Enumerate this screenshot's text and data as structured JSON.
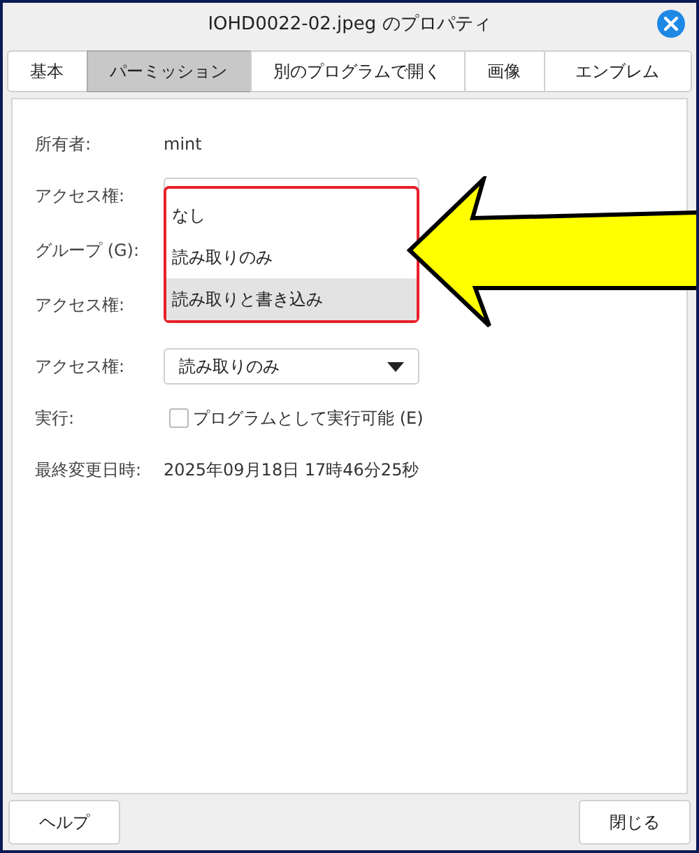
{
  "window": {
    "title": "IOHD0022-02.jpeg のプロパティ"
  },
  "tabs": [
    {
      "label": "基本",
      "selected": false
    },
    {
      "label": "パーミッション",
      "selected": true
    },
    {
      "label": "別のプログラムで開く",
      "selected": false
    },
    {
      "label": "画像",
      "selected": false
    },
    {
      "label": "エンブレム",
      "selected": false
    }
  ],
  "rows": [
    {
      "kind": "text",
      "label": "所有者:",
      "value": "mint"
    },
    {
      "kind": "select",
      "label": "アクセス権:"
    },
    {
      "kind": "label",
      "label": "グループ (G):"
    },
    {
      "kind": "label",
      "label": "アクセス権:"
    },
    {
      "kind": "select",
      "label": "アクセス権:",
      "value": "読み取りのみ"
    },
    {
      "kind": "checkbox",
      "label": "実行:",
      "text": "プログラムとして実行可能 (E)",
      "checked": false
    },
    {
      "kind": "text",
      "label": "最終変更日時:",
      "value": "2025年09月18日 17時46分25秒"
    }
  ],
  "dropdown": {
    "options": [
      {
        "label": "なし",
        "selected": false
      },
      {
        "label": "読み取りのみ",
        "selected": false
      },
      {
        "label": "読み取りと書き込み",
        "selected": true
      }
    ]
  },
  "buttons": [
    "ヘルプ",
    "閉じる"
  ]
}
